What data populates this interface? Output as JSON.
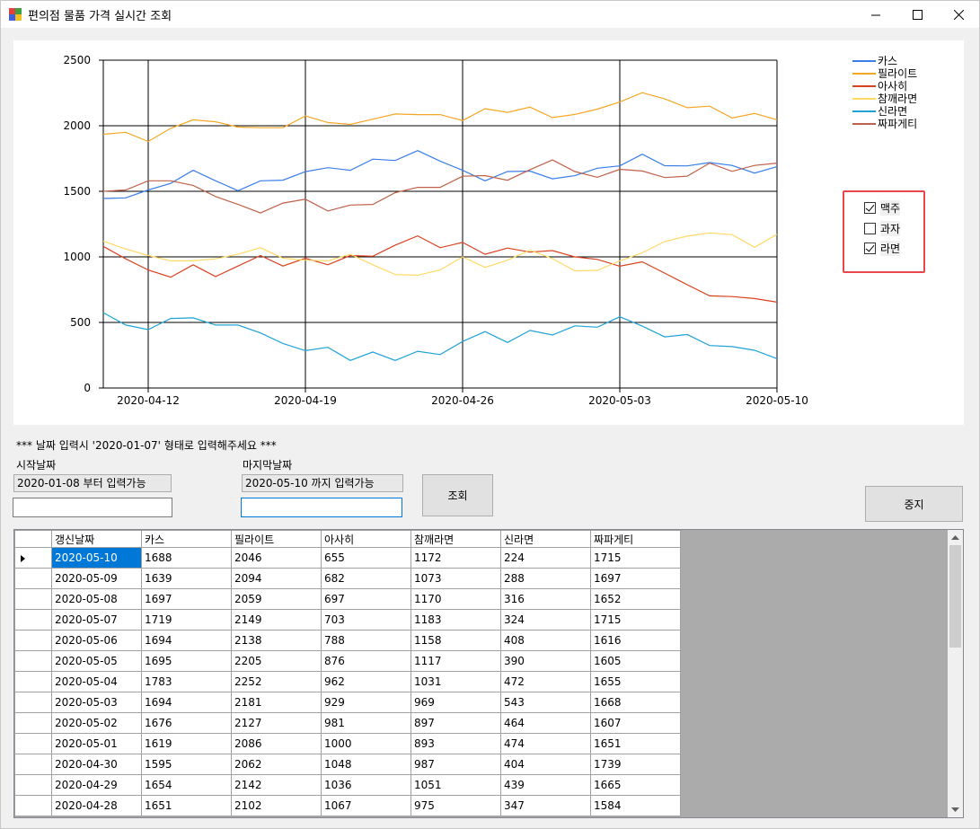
{
  "window": {
    "title": "편의점 물품 가격 실시간 조회"
  },
  "colors": {
    "카스": "#3a7ee8",
    "필라이트": "#f5a623",
    "아사히": "#d9411e",
    "참깨라면": "#ffd966",
    "신라면": "#1fa2d6",
    "짜파게티": "#c0604a"
  },
  "chart_data": {
    "type": "line",
    "x": [
      "2020-04-10",
      "2020-04-11",
      "2020-04-12",
      "2020-04-13",
      "2020-04-14",
      "2020-04-15",
      "2020-04-16",
      "2020-04-17",
      "2020-04-18",
      "2020-04-19",
      "2020-04-20",
      "2020-04-21",
      "2020-04-22",
      "2020-04-23",
      "2020-04-24",
      "2020-04-25",
      "2020-04-26",
      "2020-04-27",
      "2020-04-28",
      "2020-04-29",
      "2020-04-30",
      "2020-05-01",
      "2020-05-02",
      "2020-05-03",
      "2020-05-04",
      "2020-05-05",
      "2020-05-06",
      "2020-05-07",
      "2020-05-08",
      "2020-05-09",
      "2020-05-10"
    ],
    "x_ticks": [
      "2020-04-12",
      "2020-04-19",
      "2020-04-26",
      "2020-05-03",
      "2020-05-10"
    ],
    "y_ticks": [
      0,
      500,
      1000,
      1500,
      2000,
      2500
    ],
    "ylim": [
      0,
      2500
    ],
    "grid": true,
    "legend_position": "top-right",
    "series": [
      {
        "name": "카스",
        "values": [
          1445,
          1450,
          1510,
          1560,
          1660,
          1580,
          1505,
          1580,
          1585,
          1650,
          1680,
          1660,
          1745,
          1735,
          1810,
          1730,
          1660,
          1580,
          1651,
          1654,
          1595,
          1619,
          1676,
          1694,
          1783,
          1695,
          1694,
          1719,
          1697,
          1639,
          1688
        ]
      },
      {
        "name": "필라이트",
        "values": [
          1935,
          1950,
          1880,
          1980,
          2045,
          2030,
          1990,
          1985,
          1985,
          2075,
          2025,
          2010,
          2050,
          2090,
          2085,
          2085,
          2040,
          2130,
          2102,
          2142,
          2062,
          2086,
          2127,
          2181,
          2252,
          2205,
          2138,
          2149,
          2059,
          2094,
          2046
        ]
      },
      {
        "name": "아사히",
        "values": [
          1080,
          985,
          900,
          845,
          940,
          850,
          930,
          1010,
          930,
          990,
          940,
          1010,
          1005,
          1090,
          1160,
          1070,
          1110,
          1020,
          1067,
          1036,
          1048,
          1000,
          981,
          929,
          962,
          876,
          788,
          703,
          697,
          682,
          655
        ]
      },
      {
        "name": "참깨라면",
        "values": [
          1120,
          1060,
          1010,
          970,
          970,
          985,
          1020,
          1070,
          990,
          975,
          970,
          1020,
          940,
          865,
          860,
          900,
          1000,
          920,
          975,
          1051,
          987,
          893,
          897,
          969,
          1031,
          1117,
          1158,
          1183,
          1170,
          1073,
          1172
        ]
      },
      {
        "name": "신라면",
        "values": [
          575,
          480,
          445,
          530,
          535,
          480,
          480,
          420,
          340,
          285,
          310,
          210,
          275,
          210,
          280,
          255,
          355,
          430,
          347,
          439,
          404,
          474,
          464,
          543,
          472,
          390,
          408,
          324,
          316,
          288,
          224
        ]
      },
      {
        "name": "짜파게티",
        "values": [
          1500,
          1510,
          1580,
          1580,
          1545,
          1460,
          1400,
          1335,
          1410,
          1440,
          1350,
          1395,
          1400,
          1490,
          1530,
          1530,
          1615,
          1620,
          1584,
          1665,
          1739,
          1651,
          1607,
          1668,
          1655,
          1605,
          1616,
          1715,
          1652,
          1697,
          1715
        ]
      }
    ]
  },
  "checkboxes": [
    {
      "label": "맥주",
      "checked": true
    },
    {
      "label": "과자",
      "checked": false
    },
    {
      "label": "라면",
      "checked": true
    }
  ],
  "form": {
    "hint": "*** 날짜 입력시 '2020-01-07' 형태로 입력해주세요 ***",
    "start_label": "시작날짜",
    "start_info": "2020-01-08 부터 입력가능",
    "start_value": "",
    "end_label": "마지막날짜",
    "end_info": "2020-05-10 까지 입력가능",
    "end_value": "",
    "search_button": "조회",
    "stop_button": "중지"
  },
  "grid": {
    "columns": [
      "갱신날짜",
      "카스",
      "필라이트",
      "아사히",
      "참깨라면",
      "신라면",
      "짜파게티"
    ],
    "rows": [
      [
        "2020-05-10",
        "1688",
        "2046",
        "655",
        "1172",
        "224",
        "1715"
      ],
      [
        "2020-05-09",
        "1639",
        "2094",
        "682",
        "1073",
        "288",
        "1697"
      ],
      [
        "2020-05-08",
        "1697",
        "2059",
        "697",
        "1170",
        "316",
        "1652"
      ],
      [
        "2020-05-07",
        "1719",
        "2149",
        "703",
        "1183",
        "324",
        "1715"
      ],
      [
        "2020-05-06",
        "1694",
        "2138",
        "788",
        "1158",
        "408",
        "1616"
      ],
      [
        "2020-05-05",
        "1695",
        "2205",
        "876",
        "1117",
        "390",
        "1605"
      ],
      [
        "2020-05-04",
        "1783",
        "2252",
        "962",
        "1031",
        "472",
        "1655"
      ],
      [
        "2020-05-03",
        "1694",
        "2181",
        "929",
        "969",
        "543",
        "1668"
      ],
      [
        "2020-05-02",
        "1676",
        "2127",
        "981",
        "897",
        "464",
        "1607"
      ],
      [
        "2020-05-01",
        "1619",
        "2086",
        "1000",
        "893",
        "474",
        "1651"
      ],
      [
        "2020-04-30",
        "1595",
        "2062",
        "1048",
        "987",
        "404",
        "1739"
      ],
      [
        "2020-04-29",
        "1654",
        "2142",
        "1036",
        "1051",
        "439",
        "1665"
      ],
      [
        "2020-04-28",
        "1651",
        "2102",
        "1067",
        "975",
        "347",
        "1584"
      ]
    ]
  }
}
